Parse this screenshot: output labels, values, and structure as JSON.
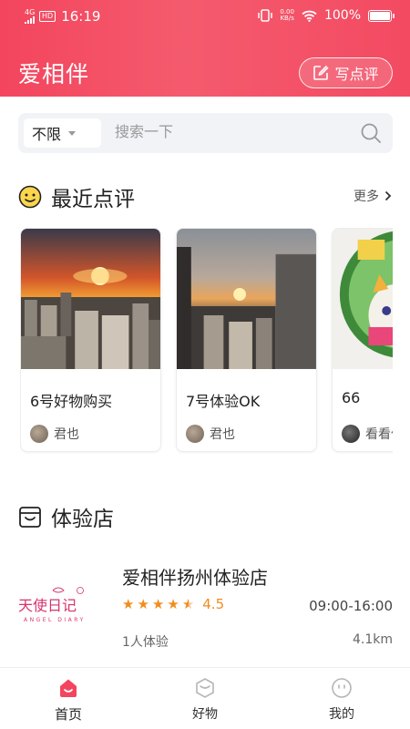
{
  "status": {
    "network": "4G",
    "hd": "HD",
    "time": "16:19",
    "speed_value": "0.00",
    "speed_unit": "KB/s",
    "battery": "100%"
  },
  "header": {
    "title": "爱相伴",
    "write_review_label": "写点评"
  },
  "search": {
    "filter_value": "不限",
    "placeholder": "搜索一下"
  },
  "recent_reviews": {
    "title": "最近点评",
    "more_label": "更多",
    "items": [
      {
        "title": "6号好物购买",
        "user": "君也"
      },
      {
        "title": "7号体验OK",
        "user": "君也"
      },
      {
        "title": "66",
        "user": "看看体"
      }
    ]
  },
  "stores": {
    "title": "体验店",
    "items": [
      {
        "name": "爱相伴扬州体验店",
        "rating": "4.5",
        "rating_value": 4.5,
        "hours": "09:00-16:00",
        "visits": "1人体验",
        "distance": "4.1km",
        "logo_text": "天使日记",
        "logo_subtext": "ANGEL DIARY"
      }
    ]
  },
  "tabbar": {
    "items": [
      {
        "label": "首页",
        "icon": "home-icon",
        "active": true
      },
      {
        "label": "好物",
        "icon": "box-icon",
        "active": false
      },
      {
        "label": "我的",
        "icon": "profile-face-icon",
        "active": false
      }
    ]
  },
  "colors": {
    "brand": "#f3455e",
    "rating": "#f28c1c"
  }
}
